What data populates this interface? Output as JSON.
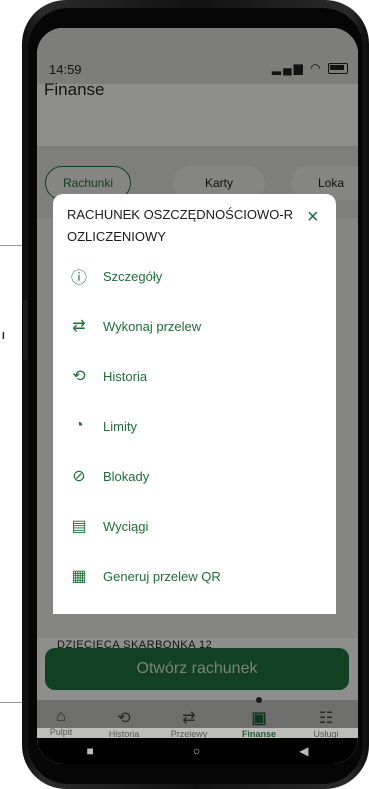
{
  "status_bar": {
    "time": "14:59",
    "icons": "signal wifi battery"
  },
  "header": {
    "title": "Finanse"
  },
  "tabs": [
    {
      "label": "Rachunki",
      "active": true
    },
    {
      "label": "Karty",
      "active": false
    },
    {
      "label": "Loka",
      "active": false
    }
  ],
  "background_text": {
    "account_label": "DZIECIĘCA SKARBONKA 12"
  },
  "open_account_button": "Otwórz rachunek",
  "modal": {
    "title_line1": "RACHUNEK OSZCZĘDNOŚCIOWO-R",
    "title_line2": "OZLICZENIOWY",
    "close": "×",
    "items": [
      {
        "label": "Szczegóły",
        "icon": "info-circle-icon"
      },
      {
        "label": "Wykonaj przelew",
        "icon": "transfer-arrows-icon"
      },
      {
        "label": "Historia",
        "icon": "history-icon"
      },
      {
        "label": "Limity",
        "icon": "gauge-icon"
      },
      {
        "label": "Blokady",
        "icon": "block-icon"
      },
      {
        "label": "Wyciągi",
        "icon": "document-icon"
      },
      {
        "label": "Generuj przelew QR",
        "icon": "qr-code-icon"
      }
    ]
  },
  "bottom_nav": [
    {
      "label": "Pulpit",
      "icon": "home-icon"
    },
    {
      "label": "Historia",
      "icon": "history-icon"
    },
    {
      "label": "Przelewy",
      "icon": "transfer-icon"
    },
    {
      "label": "Finanse",
      "icon": "wallet-icon",
      "active": true
    },
    {
      "label": "Usługi",
      "icon": "services-icon"
    }
  ],
  "callout_label": "I",
  "colors": {
    "accent": "#1e6e3c",
    "overlay": "rgba(0,0,0,0.42)"
  }
}
